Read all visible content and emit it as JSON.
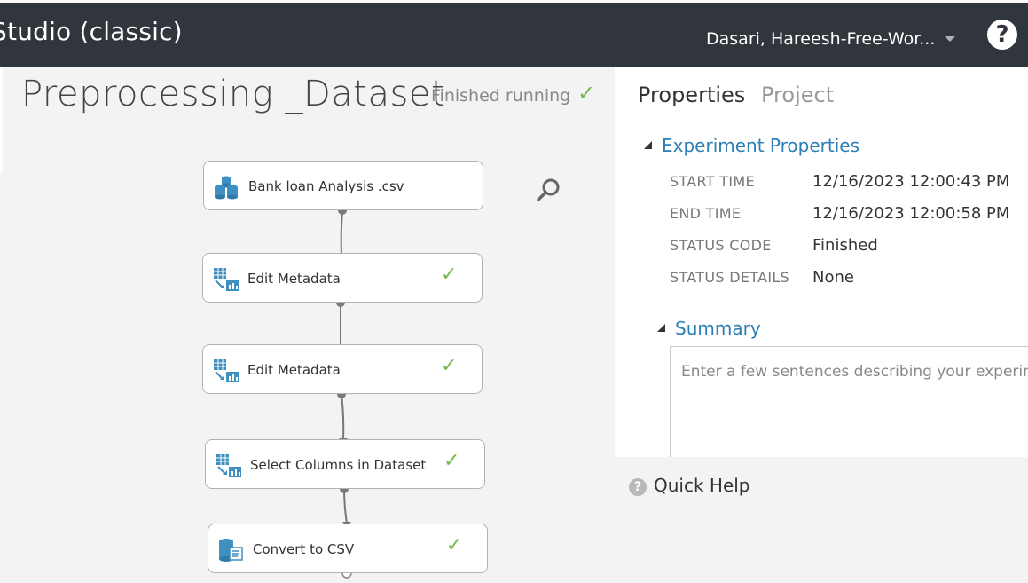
{
  "topbar": {
    "app_title": "Studio (classic)",
    "user": "Dasari, Hareesh-Free-Wor...",
    "help_glyph": "?"
  },
  "experiment": {
    "title": "Preprocessing _Dataset",
    "status": "Finished running"
  },
  "modules": [
    {
      "label": "Bank loan Analysis .csv",
      "icon": "dataset-icon",
      "finished": false
    },
    {
      "label": "Edit Metadata",
      "icon": "table-transform-icon",
      "finished": true
    },
    {
      "label": "Edit Metadata",
      "icon": "table-transform-icon",
      "finished": true
    },
    {
      "label": "Select Columns in Dataset",
      "icon": "table-transform-icon",
      "finished": true
    },
    {
      "label": "Convert to CSV",
      "icon": "database-convert-icon",
      "finished": true
    }
  ],
  "properties": {
    "tabs": [
      "Properties",
      "Project"
    ],
    "experiment_section": "Experiment Properties",
    "rows": [
      {
        "key": "START TIME",
        "value": "12/16/2023 12:00:43 PM"
      },
      {
        "key": "END TIME",
        "value": "12/16/2023 12:00:58 PM"
      },
      {
        "key": "STATUS CODE",
        "value": "Finished"
      },
      {
        "key": "STATUS DETAILS",
        "value": "None"
      }
    ],
    "summary_section": "Summary",
    "summary_placeholder": "Enter a few sentences describing your experiment"
  },
  "quick_help": {
    "label": "Quick Help"
  },
  "colors": {
    "topbar": "#30363c",
    "accent_blue": "#2a7fb4",
    "check_green": "#78b94a",
    "module_icon_blue": "#3f8fc0"
  }
}
